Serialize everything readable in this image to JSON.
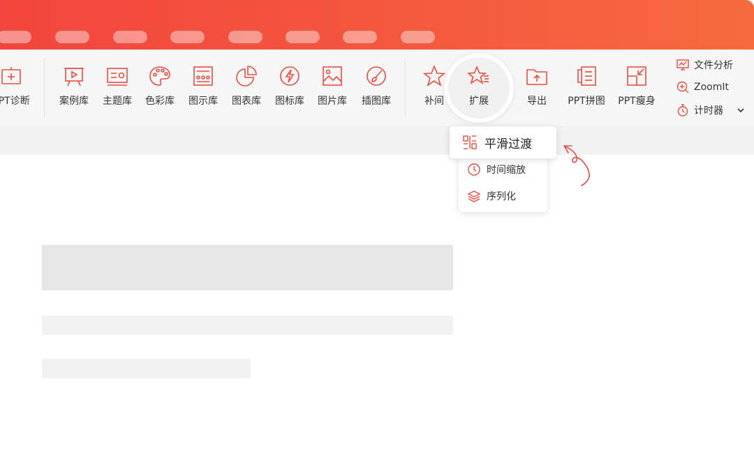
{
  "colors": {
    "brand_red": "#ee4b3f",
    "titlebar_start": "#f2453d",
    "titlebar_end": "#f66a3e"
  },
  "titlebar": {
    "tab_placeholders": 8
  },
  "ribbon": {
    "tools": [
      {
        "label": "PPT诊断",
        "icon": "presentation-plus-icon"
      },
      {
        "label": "案例库",
        "icon": "presentation-board-icon"
      },
      {
        "label": "主题库",
        "icon": "slide-layout-icon"
      },
      {
        "label": "色彩库",
        "icon": "palette-icon"
      },
      {
        "label": "图示库",
        "icon": "diagram-grid-icon"
      },
      {
        "label": "图表库",
        "icon": "pie-chart-icon"
      },
      {
        "label": "图标库",
        "icon": "lightning-circle-icon"
      },
      {
        "label": "图片库",
        "icon": "image-icon"
      },
      {
        "label": "插图库",
        "icon": "brush-circle-icon"
      },
      {
        "label": "补间",
        "icon": "star-icon"
      },
      {
        "label": "扩展",
        "icon": "star-list-icon"
      },
      {
        "label": "导出",
        "icon": "export-folder-icon"
      },
      {
        "label": "PPT拼图",
        "icon": "stack-pages-icon"
      },
      {
        "label": "PPT瘦身",
        "icon": "compress-icon"
      }
    ],
    "side_items": [
      {
        "label": "文件分析",
        "icon": "monitor-chart-icon"
      },
      {
        "label": "ZoomIt",
        "icon": "zoom-in-icon"
      },
      {
        "label": "计时器",
        "icon": "stopwatch-icon"
      }
    ]
  },
  "dropdown": {
    "highlight": {
      "label": "平滑过渡",
      "icon": "smooth-transition-icon"
    },
    "items": [
      {
        "label": "时间缩放",
        "icon": "clock-icon"
      },
      {
        "label": "序列化",
        "icon": "layers-icon"
      }
    ]
  }
}
